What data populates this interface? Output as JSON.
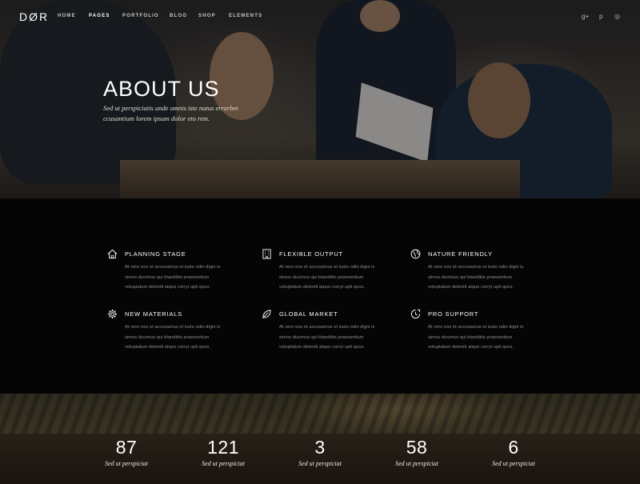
{
  "brand": {
    "logo": "DØR"
  },
  "nav": {
    "items": [
      {
        "label": "HOME"
      },
      {
        "label": "PAGES"
      },
      {
        "label": "PORTFOLIO"
      },
      {
        "label": "BLOG"
      },
      {
        "label": "SHOP"
      },
      {
        "label": "ELEMENTS"
      }
    ],
    "social": [
      {
        "icon": "google-plus-icon",
        "glyph": "g+"
      },
      {
        "icon": "pinterest-icon",
        "glyph": "p"
      },
      {
        "icon": "dribbble-icon",
        "glyph": "◎"
      }
    ]
  },
  "hero": {
    "title": "ABOUT US",
    "subtitle": "Sed ut perspiciatis unde omnis iste natus errorbet ccusantium lorem ipsum dolor eto rem."
  },
  "features": [
    {
      "icon": "home-icon",
      "title": "PLANNING STAGE",
      "text": "At vero eos et accusamus et iusto odio digni is simos ducimus qui blanditiis praesentium voluptatum deleniti atque corryi upti quos."
    },
    {
      "icon": "building-icon",
      "title": "FLEXIBLE OUTPUT",
      "text": "At vero eos et accusamus et iusto odio digni is simos ducimus qui blanditiis praesentium voluptatum deleniti atque corryi upti quos."
    },
    {
      "icon": "globe-icon",
      "title": "NATURE FRIENDLY",
      "text": "At vero eos et accusamus et iusto odio digni is simos ducimus qui blanditiis praesentium voluptatum deleniti atque corryi upti quos."
    },
    {
      "icon": "gear-icon",
      "title": "NEW MATERIALS",
      "text": "At vero eos et accusamus et iusto odio digni is simos ducimus qui blanditiis praesentium voluptatum deleniti atque corryi upti quos."
    },
    {
      "icon": "leaf-icon",
      "title": "GLOBAL MARKET",
      "text": "At vero eos et accusamus et iusto odio digni is simos ducimus qui blanditiis praesentium voluptatum deleniti atque corryi upti quos."
    },
    {
      "icon": "clock-icon",
      "title": "PRO SUPPORT",
      "text": "At vero eos et accusamus et iusto odio digni is simos ducimus qui blanditiis praesentium voluptatum deleniti atque corryi upti quos."
    }
  ],
  "counters": [
    {
      "value": "87",
      "label": "Sed ut perspiciat"
    },
    {
      "value": "121",
      "label": "Sed ut perspiciat"
    },
    {
      "value": "3",
      "label": "Sed ut perspiciat"
    },
    {
      "value": "58",
      "label": "Sed ut perspiciat"
    },
    {
      "value": "6",
      "label": "Sed ut perspiciat"
    }
  ]
}
